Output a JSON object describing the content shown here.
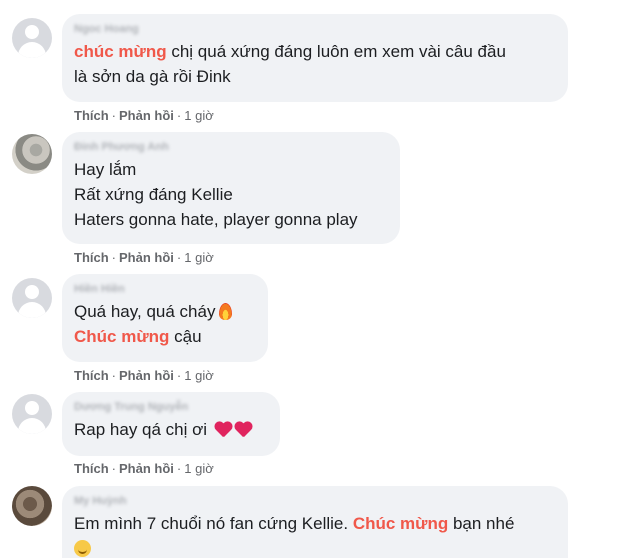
{
  "actions": {
    "like_label": "Thích",
    "reply_label": "Phản hồi",
    "separator": "·"
  },
  "comments": [
    {
      "author": "Ngoc Hoang",
      "text_parts": [
        {
          "text": "chúc mừng",
          "highlight": true
        },
        {
          "text": " chị quá xứng đáng luôn em xem vài câu đầu",
          "highlight": false
        }
      ],
      "line2": "là sởn da gà rồi Đink",
      "time": "1 giờ"
    },
    {
      "author": "Đinh Phương Anh",
      "line1": "Hay lắm",
      "line2": "Rất xứng đáng Kellie",
      "line3": "Haters gonna hate, player gonna play",
      "time": "1 giờ"
    },
    {
      "author": "Hiền Hiền",
      "line1": "Quá hay, quá cháy",
      "line1_emoji": "fire-icon",
      "line2_highlight": "Chúc mừng",
      "line2_rest": " cậu",
      "time": "1 giờ"
    },
    {
      "author": "Dương Trung Nguyễn",
      "line1": "Rap hay qá chị ơi",
      "line1_emoji": "red-heart-icon",
      "time": "1 giờ"
    },
    {
      "author": "My Huỳnh",
      "line1_a": "Em mình 7 chuổi nó fan cứng Kellie. ",
      "line1_highlight": "Chúc mừng",
      "line1_b": " bạn nhé",
      "line2_emoji": "smiling-face-icon"
    }
  ],
  "colors": {
    "bubble_bg": "#f0f2f5",
    "highlight": "#f0584a",
    "meta_text": "#65676b"
  }
}
